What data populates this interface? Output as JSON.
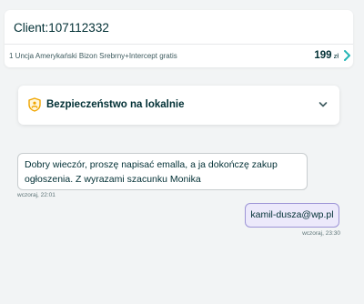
{
  "client": {
    "title": "Client:107112332",
    "ad_title": "1 Uncja Amerykański Bizon Srebrny+Intercept gratis",
    "price_value": "199",
    "price_currency": "zł"
  },
  "safety": {
    "label": "Bezpieczeństwo na lokalnie"
  },
  "messages": [
    {
      "direction": "incoming",
      "text": "Dobry wieczór, proszę napisać emalla, a ja dokończę zakup ogłoszenia. Z wyrazami szacunku Monika",
      "time": "wczoraj, 22:01"
    },
    {
      "direction": "outgoing",
      "text": "kamil-dusza@wp.pl",
      "time": "wczoraj, 23:30"
    }
  ],
  "colors": {
    "accent_teal": "#23b5b5",
    "shield_orange": "#f0a500",
    "outgoing_bubble": "#ece9fb",
    "outgoing_border": "#9d94d6"
  },
  "icons": {
    "ad_arrow": "chevron-right-icon",
    "safety": "shield-icon",
    "expand": "chevron-down-icon"
  }
}
